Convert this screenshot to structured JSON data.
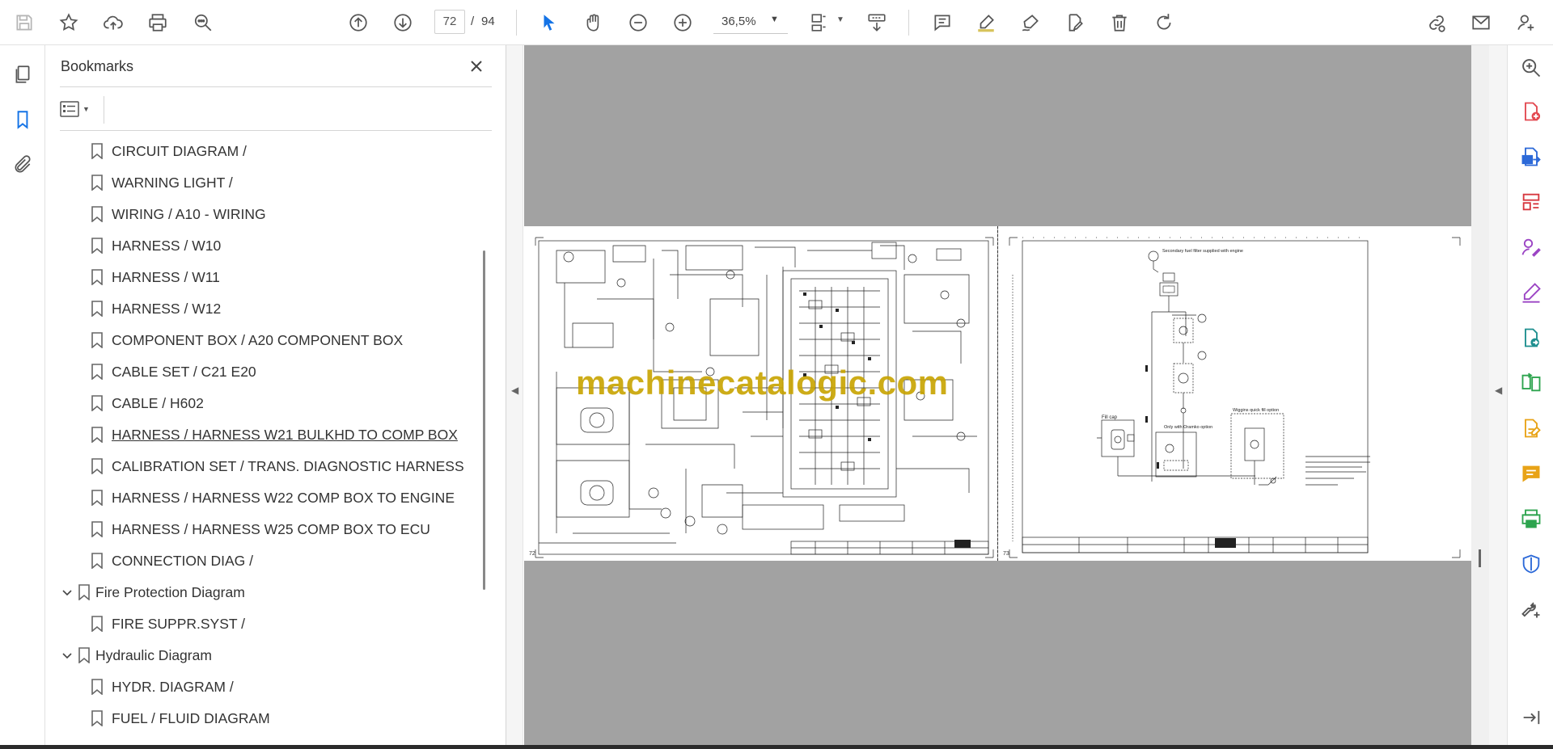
{
  "toolbar": {
    "current_page": "72",
    "page_separator": "/",
    "total_pages": "94",
    "zoom": "36,5%"
  },
  "bookmarks": {
    "title": "Bookmarks",
    "items": [
      {
        "label": "CIRCUIT DIAGRAM /",
        "level": 2,
        "expandable": false
      },
      {
        "label": "WARNING LIGHT /",
        "level": 2,
        "expandable": false
      },
      {
        "label": "WIRING / A10 - WIRING",
        "level": 2,
        "expandable": false
      },
      {
        "label": "HARNESS / W10",
        "level": 2,
        "expandable": false
      },
      {
        "label": "HARNESS / W11",
        "level": 2,
        "expandable": false
      },
      {
        "label": "HARNESS / W12",
        "level": 2,
        "expandable": false
      },
      {
        "label": "COMPONENT BOX / A20 COMPONENT BOX",
        "level": 2,
        "expandable": false
      },
      {
        "label": "CABLE SET / C21 E20",
        "level": 2,
        "expandable": false
      },
      {
        "label": "CABLE / H602",
        "level": 2,
        "expandable": false
      },
      {
        "label": "HARNESS / HARNESS W21 BULKHD TO COMP BOX",
        "level": 2,
        "expandable": false,
        "hovered": true
      },
      {
        "label": "CALIBRATION SET / TRANS. DIAGNOSTIC HARNESS",
        "level": 2,
        "expandable": false
      },
      {
        "label": "HARNESS / HARNESS W22 COMP BOX TO ENGINE",
        "level": 2,
        "expandable": false
      },
      {
        "label": "HARNESS / HARNESS W25 COMP BOX TO ECU",
        "level": 2,
        "expandable": false
      },
      {
        "label": "CONNECTION DIAG /",
        "level": 2,
        "expandable": false
      },
      {
        "label": "Fire Protection Diagram",
        "level": 1,
        "expandable": true
      },
      {
        "label": "FIRE SUPPR.SYST /",
        "level": 2,
        "expandable": false
      },
      {
        "label": "Hydraulic Diagram",
        "level": 1,
        "expandable": true
      },
      {
        "label": "HYDR. DIAGRAM /",
        "level": 2,
        "expandable": false
      },
      {
        "label": "FUEL / FLUID DIAGRAM",
        "level": 2,
        "expandable": false
      }
    ]
  },
  "document": {
    "left_page_number": "72",
    "right_page_number": "73",
    "watermark": "machinecatalogic.com",
    "right_page_labels": {
      "filter_note": "Secondary fuel filter supplied with engine",
      "fill_cap": "Fill cap",
      "oramko": "Only with Oramko option",
      "wiggins": "Wiggins quick fill option"
    }
  },
  "colors": {
    "icon_gray": "#555555",
    "accent_blue": "#1473e6",
    "doc_background": "#a2a2a2",
    "watermark": "#c8a400"
  }
}
